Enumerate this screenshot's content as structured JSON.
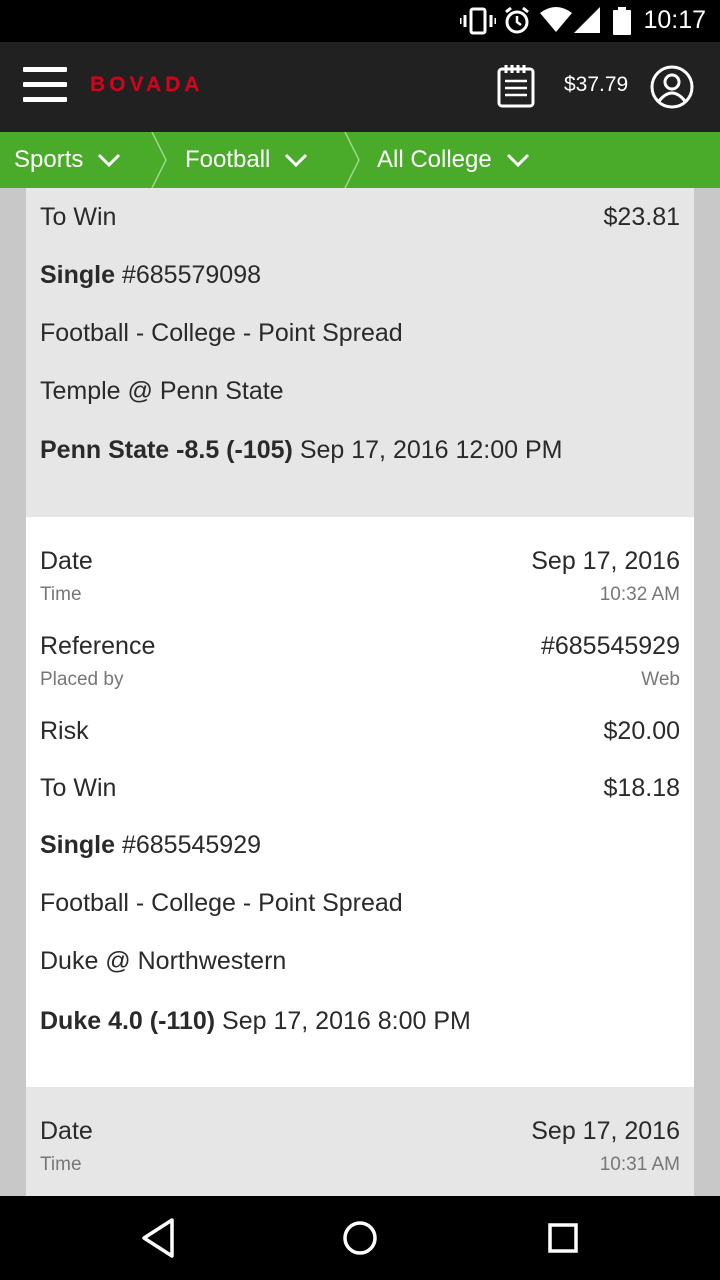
{
  "status_bar": {
    "time": "10:17",
    "icons": [
      "vibrate-icon",
      "alarm-icon",
      "wifi-icon",
      "signal-icon",
      "battery-icon"
    ]
  },
  "header": {
    "logo": "BOVADA",
    "balance": "$37.79",
    "icons": [
      "menu-icon",
      "betslip-icon",
      "account-icon"
    ],
    "colors": {
      "bar": "#212121",
      "logo": "#d9001b"
    }
  },
  "breadcrumbs": [
    {
      "label": "Sports"
    },
    {
      "label": "Football"
    },
    {
      "label": "All College"
    }
  ],
  "accent_color": "#4aab2a",
  "bets": [
    {
      "partial": true,
      "to_win_label": "To Win",
      "to_win": "$23.81",
      "type": "Single",
      "ref": "#685579098",
      "market": "Football - College - Point Spread",
      "matchup": "Temple @ Penn State",
      "selection": "Penn State -8.5 (-105)",
      "event_time": "Sep 17, 2016 12:00 PM"
    },
    {
      "date_label": "Date",
      "date": "Sep 17, 2016",
      "time_label": "Time",
      "time": "10:32 AM",
      "reference_label": "Reference",
      "reference": "#685545929",
      "placed_by_label": "Placed by",
      "placed_by": "Web",
      "risk_label": "Risk",
      "risk": "$20.00",
      "to_win_label": "To Win",
      "to_win": "$18.18",
      "type": "Single",
      "ref": "#685545929",
      "market": "Football - College - Point Spread",
      "matchup": "Duke @ Northwestern",
      "selection": "Duke 4.0 (-110)",
      "event_time": "Sep 17, 2016 8:00 PM"
    },
    {
      "partial": true,
      "date_label": "Date",
      "date": "Sep 17, 2016",
      "time_label": "Time",
      "time": "10:31 AM"
    }
  ],
  "nav_bar": {
    "icons": [
      "back-icon",
      "home-icon",
      "recents-icon"
    ]
  }
}
